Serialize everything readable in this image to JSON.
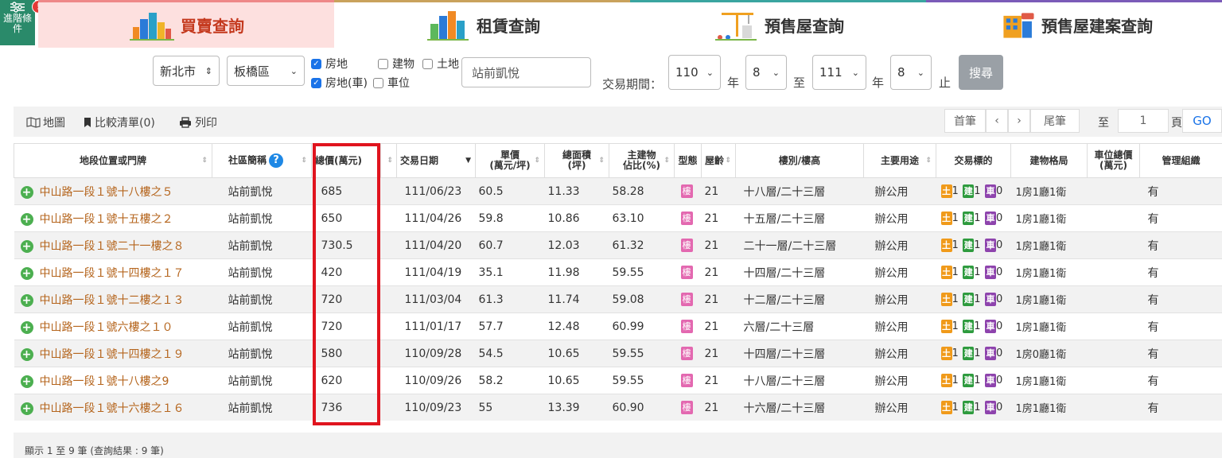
{
  "advanced": {
    "label": "進階條件",
    "badge": "!"
  },
  "tabs": [
    {
      "label": "買賣查詢",
      "icon": "city-sale-icon"
    },
    {
      "label": "租賃查詢",
      "icon": "city-rent-icon"
    },
    {
      "label": "預售屋查詢",
      "icon": "crane-icon"
    },
    {
      "label": "預售屋建案查詢",
      "icon": "new-building-icon"
    }
  ],
  "search": {
    "city": "新北市",
    "district": "板橋區",
    "chk_land_bld": "房地",
    "chk_bld": "建物",
    "chk_land": "土地",
    "chk_land_bld_car": "房地(車)",
    "chk_car": "車位",
    "keyword": "站前凱悅",
    "period_label": "交易期間：",
    "from_year": "110",
    "year_unit": "年",
    "from_month": "8",
    "to_label": "至",
    "to_year": "111",
    "to_year_unit": "年",
    "to_month": "8",
    "end_label": "止",
    "search_btn": "搜尋"
  },
  "toolbar": {
    "map": "地圖",
    "compare": "比較清單(0)",
    "print": "列印",
    "first": "首筆",
    "prev": "‹",
    "next": "›",
    "last": "尾筆",
    "to": "至",
    "page": "1",
    "page_unit": "頁",
    "go": "GO"
  },
  "columns": {
    "addr": "地段位置或門牌",
    "community": "社區簡稱",
    "total": "總價(萬元)",
    "date": "交易日期",
    "unit_price_1": "單價",
    "unit_price_2": "(萬元/坪)",
    "area_1": "總面積",
    "area_2": "(坪)",
    "main_1": "主建物",
    "main_2": "佔比(%)",
    "type": "型態",
    "age": "屋齡",
    "floor": "樓別/樓高",
    "usage": "主要用途",
    "target": "交易標的",
    "layout": "建物格局",
    "parking_1": "車位總價",
    "parking_2": "(萬元)",
    "mgmt": "管理組織"
  },
  "tag_labels": {
    "land": "土",
    "bld": "建",
    "car": "車"
  },
  "rows": [
    {
      "addr": "中山路一段１號十八樓之５",
      "community": "站前凱悅",
      "total": "685",
      "date": "111/06/23",
      "unit": "60.5",
      "area": "11.33",
      "main": "58.28",
      "type": "樓",
      "age": "21",
      "floor": "十八層/二十三層",
      "usage": "辦公用",
      "land": "1",
      "bld": "1",
      "car": "0",
      "layout": "1房1廳1衛",
      "parking": "",
      "mgmt": "有"
    },
    {
      "addr": "中山路一段１號十五樓之２",
      "community": "站前凱悅",
      "total": "650",
      "date": "111/04/26",
      "unit": "59.8",
      "area": "10.86",
      "main": "63.10",
      "type": "樓",
      "age": "21",
      "floor": "十五層/二十三層",
      "usage": "辦公用",
      "land": "1",
      "bld": "1",
      "car": "0",
      "layout": "1房1廳1衛",
      "parking": "",
      "mgmt": "有"
    },
    {
      "addr": "中山路一段１號二十一樓之８",
      "community": "站前凱悅",
      "total": "730.5",
      "date": "111/04/20",
      "unit": "60.7",
      "area": "12.03",
      "main": "61.32",
      "type": "樓",
      "age": "21",
      "floor": "二十一層/二十三層",
      "usage": "辦公用",
      "land": "1",
      "bld": "1",
      "car": "0",
      "layout": "1房1廳1衛",
      "parking": "",
      "mgmt": "有"
    },
    {
      "addr": "中山路一段１號十四樓之１７",
      "community": "站前凱悅",
      "total": "420",
      "date": "111/04/19",
      "unit": "35.1",
      "area": "11.98",
      "main": "59.55",
      "type": "樓",
      "age": "21",
      "floor": "十四層/二十三層",
      "usage": "辦公用",
      "land": "1",
      "bld": "1",
      "car": "0",
      "layout": "1房1廳1衛",
      "parking": "",
      "mgmt": "有"
    },
    {
      "addr": "中山路一段１號十二樓之１３",
      "community": "站前凱悅",
      "total": "720",
      "date": "111/03/04",
      "unit": "61.3",
      "area": "11.74",
      "main": "59.08",
      "type": "樓",
      "age": "21",
      "floor": "十二層/二十三層",
      "usage": "辦公用",
      "land": "1",
      "bld": "1",
      "car": "0",
      "layout": "1房1廳1衛",
      "parking": "",
      "mgmt": "有"
    },
    {
      "addr": "中山路一段１號六樓之１０",
      "community": "站前凱悅",
      "total": "720",
      "date": "111/01/17",
      "unit": "57.7",
      "area": "12.48",
      "main": "60.99",
      "type": "樓",
      "age": "21",
      "floor": "六層/二十三層",
      "usage": "辦公用",
      "land": "1",
      "bld": "1",
      "car": "0",
      "layout": "1房1廳1衛",
      "parking": "",
      "mgmt": "有"
    },
    {
      "addr": "中山路一段１號十四樓之１９",
      "community": "站前凱悅",
      "total": "580",
      "date": "110/09/28",
      "unit": "54.5",
      "area": "10.65",
      "main": "59.55",
      "type": "樓",
      "age": "21",
      "floor": "十四層/二十三層",
      "usage": "辦公用",
      "land": "1",
      "bld": "1",
      "car": "0",
      "layout": "1房0廳1衛",
      "parking": "",
      "mgmt": "有"
    },
    {
      "addr": "中山路一段１號十八樓之9",
      "community": "站前凱悅",
      "total": "620",
      "date": "110/09/26",
      "unit": "58.2",
      "area": "10.65",
      "main": "59.55",
      "type": "樓",
      "age": "21",
      "floor": "十八層/二十三層",
      "usage": "辦公用",
      "land": "1",
      "bld": "1",
      "car": "0",
      "layout": "1房1廳1衛",
      "parking": "",
      "mgmt": "有"
    },
    {
      "addr": "中山路一段１號十六樓之１６",
      "community": "站前凱悅",
      "total": "736",
      "date": "110/09/23",
      "unit": "55",
      "area": "13.39",
      "main": "60.90",
      "type": "樓",
      "age": "21",
      "floor": "十六層/二十三層",
      "usage": "辦公用",
      "land": "1",
      "bld": "1",
      "car": "0",
      "layout": "1房1廳1衛",
      "parking": "",
      "mgmt": "有"
    }
  ],
  "footer": "顯示 1 至 9 筆 (查詢結果 : 9 筆)"
}
